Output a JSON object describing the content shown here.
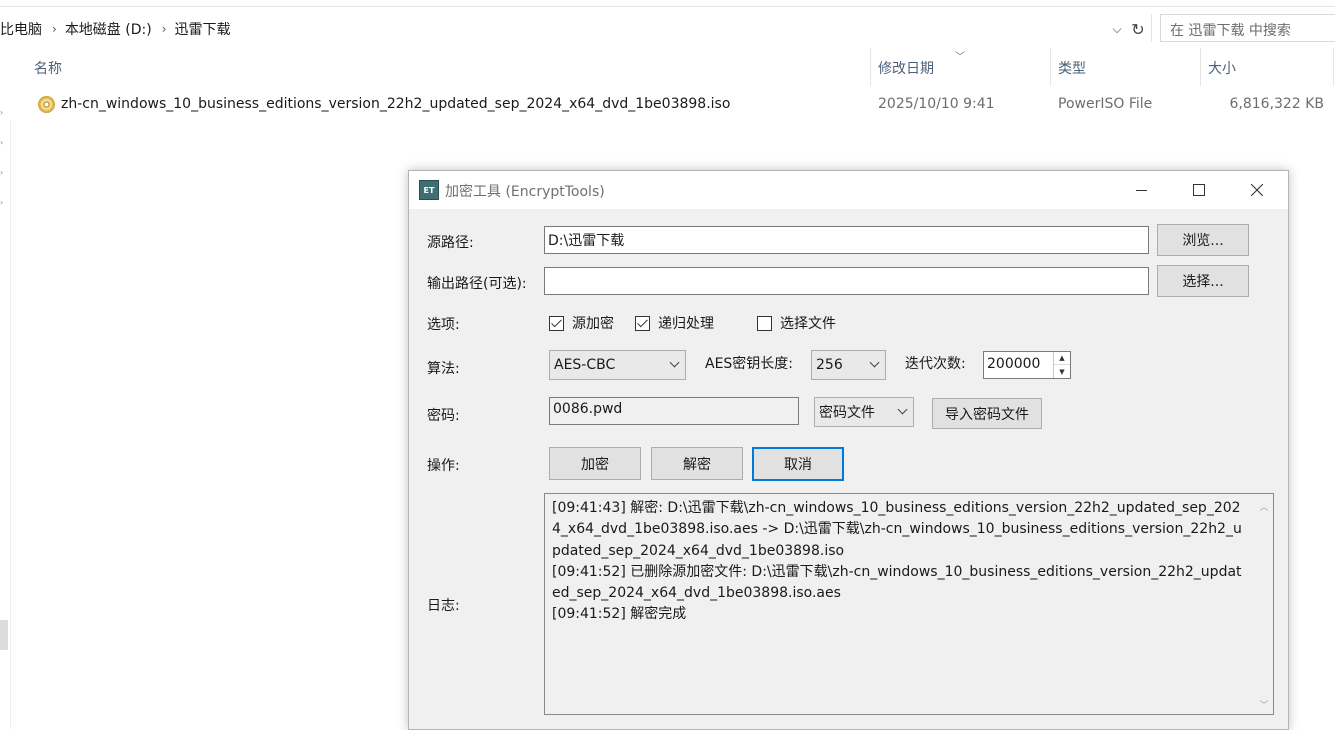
{
  "explorer": {
    "breadcrumbs": [
      "比电脑",
      "本地磁盘 (D:)",
      "迅雷下载"
    ],
    "crumb_separator": "›",
    "search_placeholder": "在 迅雷下载 中搜索",
    "columns": {
      "name": "名称",
      "modified": "修改日期",
      "type": "类型",
      "size": "大小"
    },
    "files": [
      {
        "name": "zh-cn_windows_10_business_editions_version_22h2_updated_sep_2024_x64_dvd_1be03898.iso",
        "modified": "2025/10/10 9:41",
        "type": "PowerISO File",
        "size": "6,816,322 KB",
        "icon": "disc-image-icon"
      }
    ]
  },
  "dialog": {
    "icon_text": "ET",
    "title": "加密工具 (EncryptTools)",
    "labels": {
      "source": "源路径:",
      "output": "输出路径(可选):",
      "options": "选项:",
      "algorithm": "算法:",
      "key_length": "AES密钥长度:",
      "iterations": "迭代次数:",
      "password": "密码:",
      "actions": "操作:",
      "log": "日志:"
    },
    "source_path": "D:\\迅雷下载",
    "output_path": "",
    "browse_button": "浏览...",
    "select_button": "选择...",
    "options": [
      {
        "label": "源加密",
        "checked": true
      },
      {
        "label": "递归处理",
        "checked": true
      },
      {
        "label": "选择文件",
        "checked": false
      }
    ],
    "algorithm": "AES-CBC",
    "key_length": "256",
    "iterations": "200000",
    "password": "0086.pwd",
    "password_mode": "密码文件",
    "import_button": "导入密码文件",
    "encrypt_button": "加密",
    "decrypt_button": "解密",
    "cancel_button": "取消",
    "log_lines": [
      "[09:41:43] 解密: D:\\迅雷下载\\zh-cn_windows_10_business_editions_version_22h2_updated_sep_2024_x64_dvd_1be03898.iso.aes -> D:\\迅雷下载\\zh-cn_windows_10_business_editions_version_22h2_updated_sep_2024_x64_dvd_1be03898.iso",
      "[09:41:52] 已删除源加密文件: D:\\迅雷下载\\zh-cn_windows_10_business_editions_version_22h2_updated_sep_2024_x64_dvd_1be03898.iso.aes",
      "[09:41:52] 解密完成"
    ]
  },
  "colors": {
    "accent": "#0078d7",
    "header_text": "#4c607a",
    "secondary_text": "#6d6d6d",
    "dialog_bg": "#f0f0f0"
  }
}
